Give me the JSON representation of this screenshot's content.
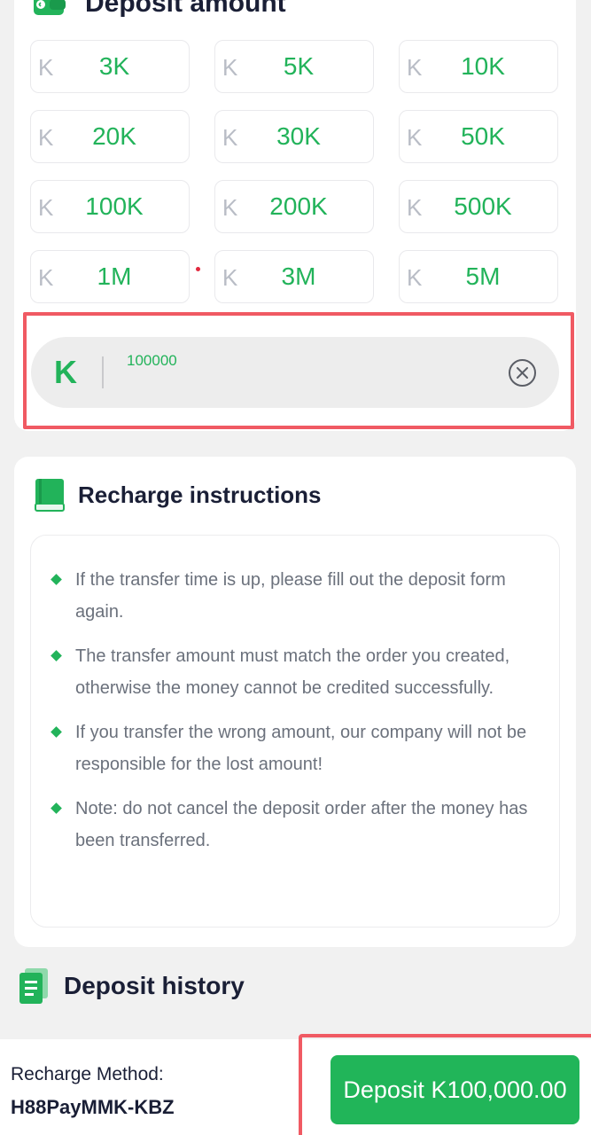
{
  "deposit_amount": {
    "title": "Deposit amount",
    "currency_symbol": "K",
    "chips": [
      {
        "value": "3K"
      },
      {
        "value": "5K"
      },
      {
        "value": "10K"
      },
      {
        "value": "20K"
      },
      {
        "value": "30K"
      },
      {
        "value": "50K"
      },
      {
        "value": "100K"
      },
      {
        "value": "200K"
      },
      {
        "value": "500K"
      },
      {
        "value": "1M"
      },
      {
        "value": "3M"
      },
      {
        "value": "5M"
      }
    ],
    "input": {
      "currency": "K",
      "value": "100000"
    }
  },
  "instructions": {
    "title": "Recharge instructions",
    "items": [
      "If the transfer time is up, please fill out the deposit form again.",
      "The transfer amount must match the order you created, otherwise the money cannot be credited successfully.",
      "If you transfer the wrong amount, our company will not be responsible for the lost amount!",
      "Note: do not cancel the deposit order after the money has been transferred."
    ]
  },
  "history": {
    "title": "Deposit history"
  },
  "bottom": {
    "method_label": "Recharge Method:",
    "method_value": "H88PayMMK-KBZ",
    "deposit_button": "Deposit K100,000.00"
  },
  "colors": {
    "accent_green": "#22b35a",
    "highlight_red": "#f05a63",
    "title_text": "#1a1f36",
    "muted_text": "#6b717c"
  },
  "icons": {
    "header": "wallet-icon",
    "instructions": "book-icon",
    "history": "document-icon",
    "clear": "clear-circle-x-icon"
  }
}
